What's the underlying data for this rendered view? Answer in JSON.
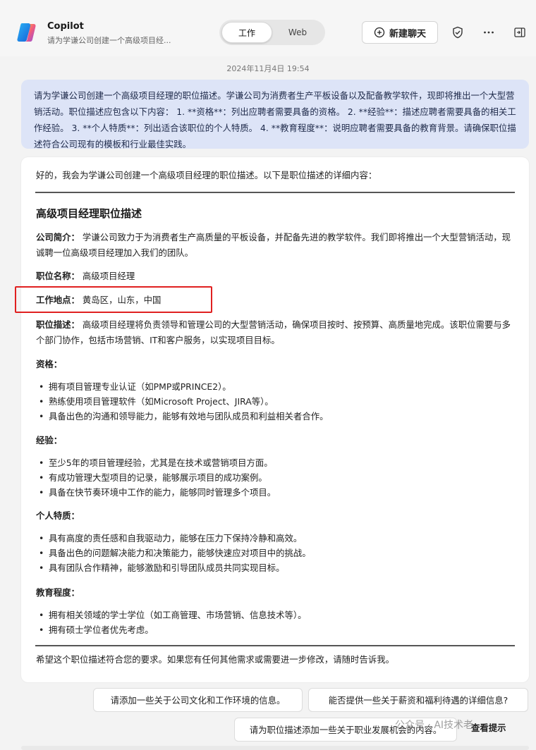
{
  "header": {
    "app_title": "Copilot",
    "subtitle": "请为学谦公司创建一个高级项目经...",
    "mode_work": "工作",
    "mode_web": "Web",
    "new_chat": "新建聊天",
    "icons": [
      "shield-icon",
      "more-icon",
      "sidebar-icon"
    ]
  },
  "timestamp": "2024年11月4日 19:54",
  "user_message": "请为学谦公司创建一个高级项目经理的职位描述。学谦公司为消费者生产平板设备以及配备教学软件，现即将推出一个大型营销活动。职位描述应包含以下内容： 1. **资格**：列出应聘者需要具备的资格。 2. **经验**：描述应聘者需要具备的相关工作经验。 3. **个人特质**：列出适合该职位的个人特质。 4. **教育程度**：说明应聘者需要具备的教育背景。请确保职位描述符合公司现有的模板和行业最佳实践。",
  "response": {
    "intro": "好的，我会为学谦公司创建一个高级项目经理的职位描述。以下是职位描述的详细内容：",
    "title": "高级项目经理职位描述",
    "company_label": "公司简介：",
    "company_text": "学谦公司致力于为消费者生产高质量的平板设备，并配备先进的教学软件。我们即将推出一个大型营销活动，现诚聘一位高级项目经理加入我们的团队。",
    "position_label": "职位名称：",
    "position_text": "高级项目经理",
    "location_label": "工作地点：",
    "location_text": "黄岛区，山东，中国",
    "desc_label": "职位描述：",
    "desc_text": "高级项目经理将负责领导和管理公司的大型营销活动，确保项目按时、按预算、高质量地完成。该职位需要与多个部门协作，包括市场营销、IT和客户服务，以实现项目目标。",
    "sections": [
      {
        "heading": "资格：",
        "items": [
          "拥有项目管理专业认证（如PMP或PRINCE2）。",
          "熟练使用项目管理软件（如Microsoft Project、JIRA等）。",
          "具备出色的沟通和领导能力，能够有效地与团队成员和利益相关者合作。"
        ]
      },
      {
        "heading": "经验：",
        "items": [
          "至少5年的项目管理经验，尤其是在技术或营销项目方面。",
          "有成功管理大型项目的记录，能够展示项目的成功案例。",
          "具备在快节奏环境中工作的能力，能够同时管理多个项目。"
        ]
      },
      {
        "heading": "个人特质：",
        "items": [
          "具有高度的责任感和自我驱动力，能够在压力下保持冷静和高效。",
          "具备出色的问题解决能力和决策能力，能够快速应对项目中的挑战。",
          "具有团队合作精神，能够激励和引导团队成员共同实现目标。"
        ]
      },
      {
        "heading": "教育程度：",
        "items": [
          "拥有相关领域的学士学位（如工商管理、市场营销、信息技术等）。",
          "拥有硕士学位者优先考虑。"
        ]
      }
    ],
    "closing": "希望这个职位描述符合您的要求。如果您有任何其他需求或需要进一步修改，请随时告诉我。"
  },
  "suggestions": [
    "请添加一些关于公司文化和工作环境的信息。",
    "能否提供一些关于薪资和福利待遇的详细信息?",
    "请为职位描述添加一些关于职业发展机会的内容。"
  ],
  "watermark": "公众号 · AI技术老",
  "peek_label": "查看提示",
  "colors": {
    "user_bubble": "#dde4f7",
    "highlight": "#e02020"
  }
}
